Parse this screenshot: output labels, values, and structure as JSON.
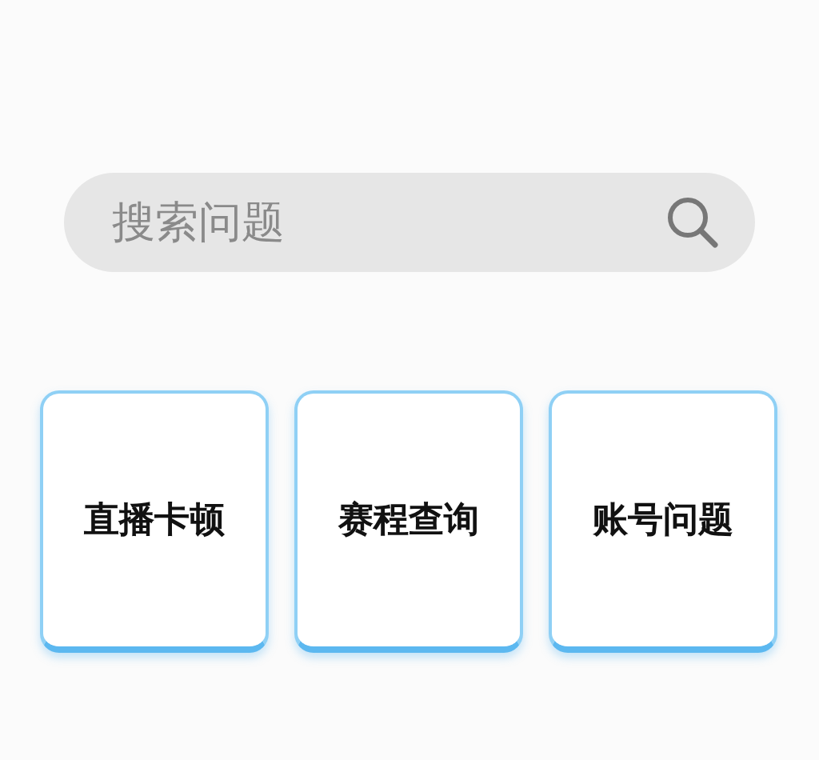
{
  "search": {
    "placeholder": "搜索问题"
  },
  "cards": [
    {
      "label": "直播卡顿"
    },
    {
      "label": "赛程查询"
    },
    {
      "label": "账号问题"
    }
  ]
}
